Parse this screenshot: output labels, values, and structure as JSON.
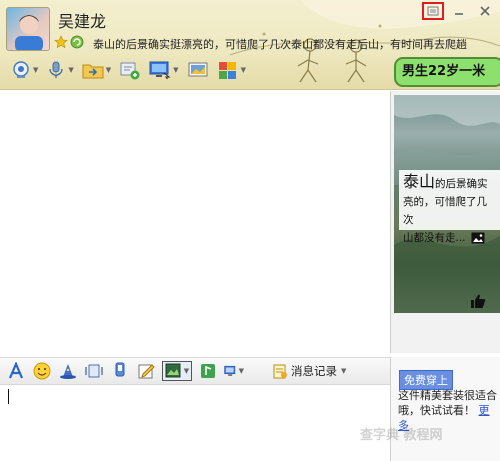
{
  "header": {
    "contact_name": "吴建龙",
    "signature": "泰山的后景确实挺漂亮的，可惜爬了几次泰山都没有走后山，有时间再去爬趟",
    "banner_text": "男生22岁一米"
  },
  "window_controls": {
    "restore": "restore-icon",
    "minimize": "minimize-icon",
    "close": "close-icon"
  },
  "toolbar_top": [
    "video-call-icon",
    "voice-call-icon",
    "file-transfer-icon",
    "add-member-icon",
    "remote-desktop-icon",
    "share-screen-icon",
    "apps-icon"
  ],
  "mini_blog": {
    "text_big": "泰山",
    "text_rest_1": "的后景确实",
    "text_line_2": "亮的，可惜爬了几次",
    "text_line_3": "山都没有走..."
  },
  "toolbar_bottom": {
    "items": [
      "font-icon",
      "emoji-icon",
      "magic-icon",
      "vibrate-icon",
      "voice-message-icon",
      "note-icon",
      "screenshot-icon",
      "image-icon",
      "screen-capture-icon"
    ],
    "history_label": "消息记录"
  },
  "promo": {
    "badge": "免费穿上",
    "line1": "这件精美套装很适合",
    "line2": "哦，快试试看！",
    "more": "更多"
  },
  "watermark": "查字典 教程网"
}
